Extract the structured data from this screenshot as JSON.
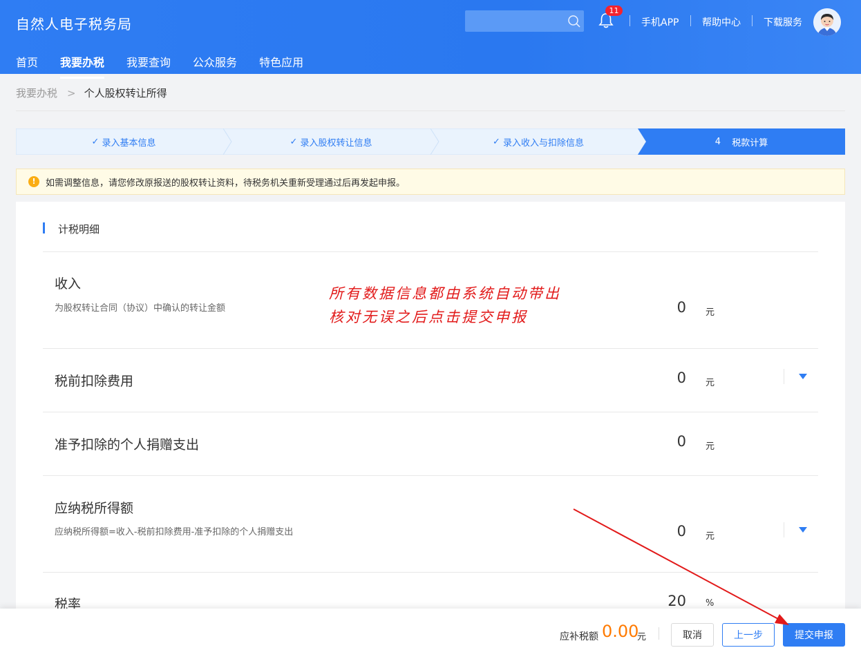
{
  "header": {
    "brand": "自然人电子税务局",
    "badge_count": "11",
    "links": [
      "手机APP",
      "帮助中心",
      "下载服务"
    ]
  },
  "nav": {
    "items": [
      "首页",
      "我要办税",
      "我要查询",
      "公众服务",
      "特色应用"
    ],
    "active": "我要办税"
  },
  "breadcrumb": {
    "parent": "我要办税",
    "current": "个人股权转让所得"
  },
  "steps": [
    {
      "label": "录入基本信息",
      "done": true
    },
    {
      "label": "录入股权转让信息",
      "done": true
    },
    {
      "label": "录入收入与扣除信息",
      "done": true
    },
    {
      "label": "税款计算",
      "number": "4",
      "active": true
    }
  ],
  "notice": {
    "icon": "!",
    "text": "如需调整信息，请您修改原报送的股权转让资料，待税务机关重新受理通过后再发起申报。"
  },
  "section": {
    "title": "计税明细"
  },
  "rows": [
    {
      "title": "收入",
      "desc": "为股权转让合同（协议）中确认的转让金额",
      "value": "0",
      "unit": "元"
    },
    {
      "title": "税前扣除费用",
      "value": "0",
      "unit": "元"
    },
    {
      "title": "准予扣除的个人捐赠支出",
      "value": "0",
      "unit": "元"
    },
    {
      "title": "应纳税所得额",
      "desc": "应纳税所得额=收入-税前扣除费用-准予扣除的个人捐赠支出",
      "value": "0",
      "unit": "元"
    },
    {
      "title": "税率",
      "value": "20",
      "unit": "%"
    }
  ],
  "annotation": {
    "line1": "所有数据信息都由系统自动带出",
    "line2": "核对无误之后点击提交申报"
  },
  "footer": {
    "due_label": "应补税额",
    "due_value": "0.00",
    "due_unit": "元",
    "cancel": "取消",
    "prev": "上一步",
    "submit": "提交申报"
  },
  "colors": {
    "primary": "#2f7df3",
    "orange": "#ff7a00",
    "annotation": "#e21a1a",
    "notice_bg": "#fffbe6"
  }
}
